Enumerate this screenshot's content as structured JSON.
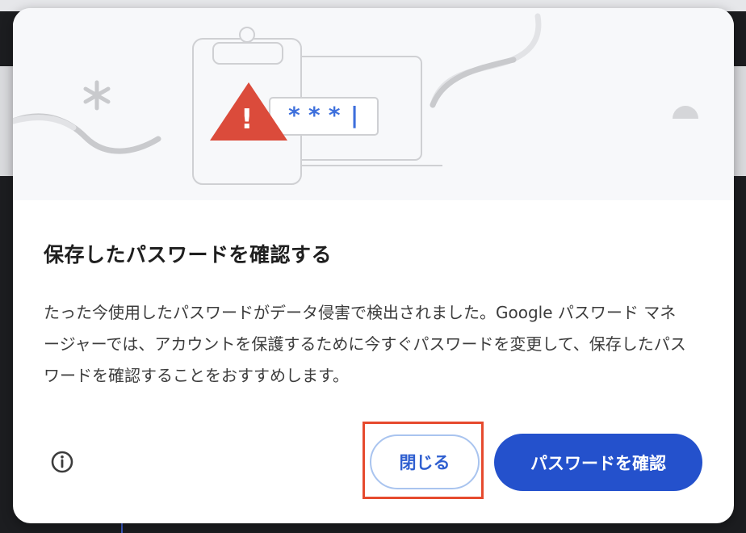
{
  "dialog": {
    "title": "保存したパスワードを確認する",
    "body": "たった今使用したパスワードがデータ侵害で検出されました。Google パスワード マネージャーでは、アカウントを保護するために今すぐパスワードを変更して、保存したパスワードを確認することをおすすめします。",
    "illustration": {
      "password_mask": "***|",
      "warning_symbol": "!"
    },
    "buttons": {
      "close_label": "閉じる",
      "confirm_label": "パスワードを確認"
    },
    "icons": {
      "info": "info-icon"
    },
    "colors": {
      "primary": "#2451cc",
      "warning": "#db4b3b",
      "highlight_border": "#e64a2e"
    }
  }
}
